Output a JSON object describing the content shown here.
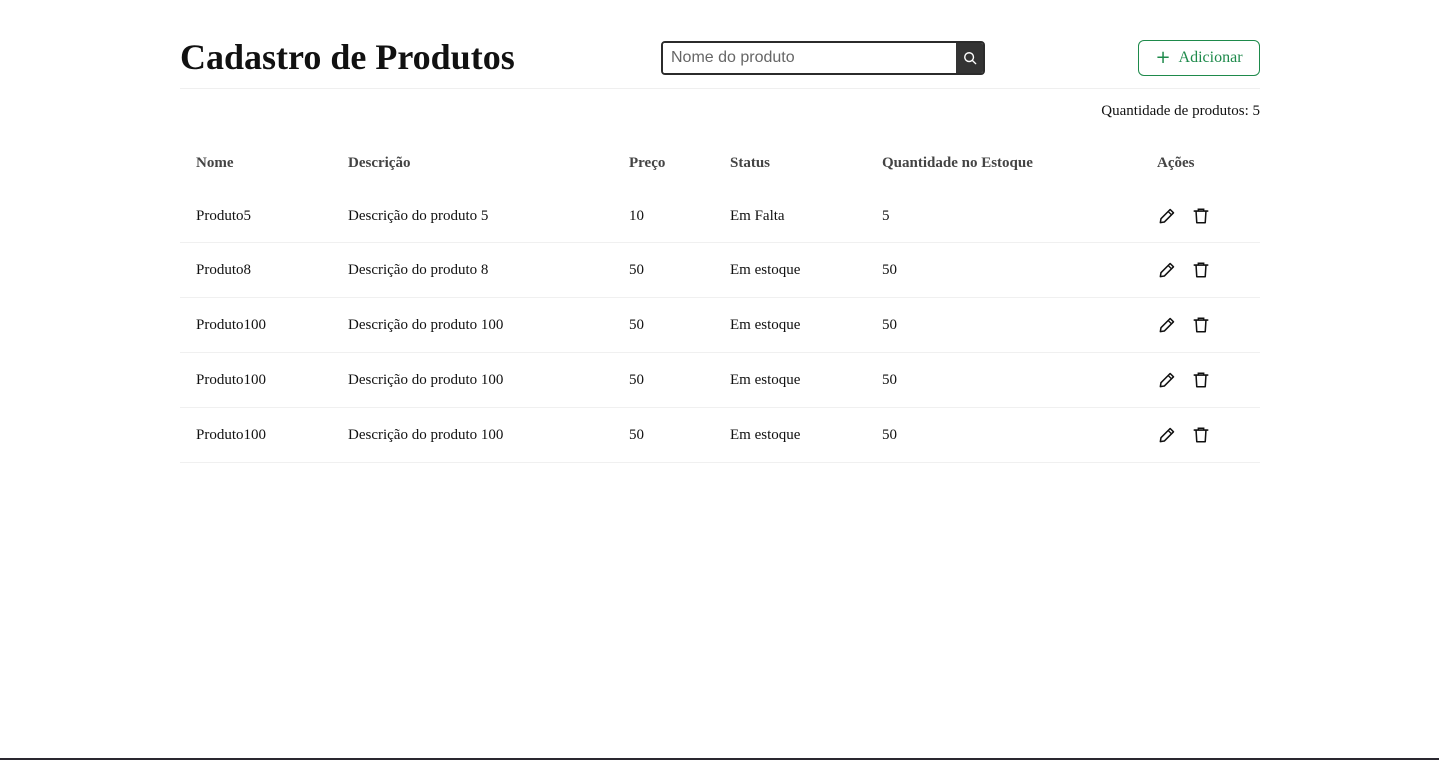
{
  "header": {
    "title": "Cadastro de Produtos",
    "search_placeholder": "Nome do produto",
    "search_value": "",
    "add_label": "Adicionar"
  },
  "summary": {
    "count_text": "Quantidade de produtos: 5"
  },
  "table": {
    "columns": [
      "Nome",
      "Descrição",
      "Preço",
      "Status",
      "Quantidade no Estoque",
      "Ações"
    ],
    "rows": [
      {
        "nome": "Produto5",
        "descricao": "Descrição do produto 5",
        "preco": "10",
        "status": "Em Falta",
        "quantidade": "5"
      },
      {
        "nome": "Produto8",
        "descricao": "Descrição do produto 8",
        "preco": "50",
        "status": "Em estoque",
        "quantidade": "50"
      },
      {
        "nome": "Produto100",
        "descricao": "Descrição do produto 100",
        "preco": "50",
        "status": "Em estoque",
        "quantidade": "50"
      },
      {
        "nome": "Produto100",
        "descricao": "Descrição do produto 100",
        "preco": "50",
        "status": "Em estoque",
        "quantidade": "50"
      },
      {
        "nome": "Produto100",
        "descricao": "Descrição do produto 100",
        "preco": "50",
        "status": "Em estoque",
        "quantidade": "50"
      }
    ]
  },
  "icons": {
    "search": "search-icon",
    "add": "plus-icon",
    "edit": "pencil-icon",
    "delete": "trash-icon"
  },
  "colors": {
    "accent": "#1e8a4b",
    "search_button": "#333333"
  }
}
